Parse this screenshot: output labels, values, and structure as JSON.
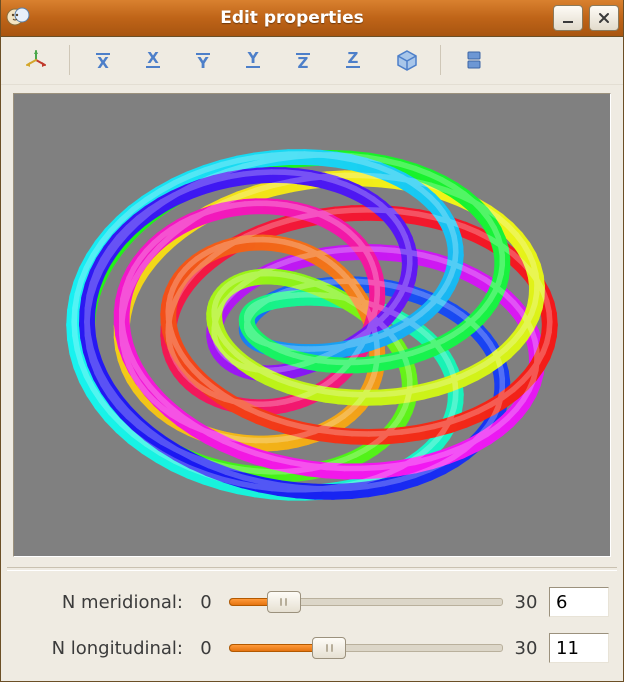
{
  "window": {
    "title": "Edit properties"
  },
  "toolbar": {
    "axes": [
      "X",
      "X",
      "Y",
      "Y",
      "Z",
      "Z"
    ]
  },
  "params": {
    "meridional": {
      "label": "N meridional:",
      "min": "0",
      "max": "30",
      "value": "6",
      "value_num": 6,
      "max_num": 30
    },
    "longitudinal": {
      "label": "N longitudinal:",
      "min": "0",
      "max": "30",
      "value": "11",
      "value_num": 11,
      "max_num": 30
    }
  },
  "colors": {
    "accent": "#e57410",
    "icon_blue": "#4d7fc9",
    "viewport_bg": "#808080"
  }
}
